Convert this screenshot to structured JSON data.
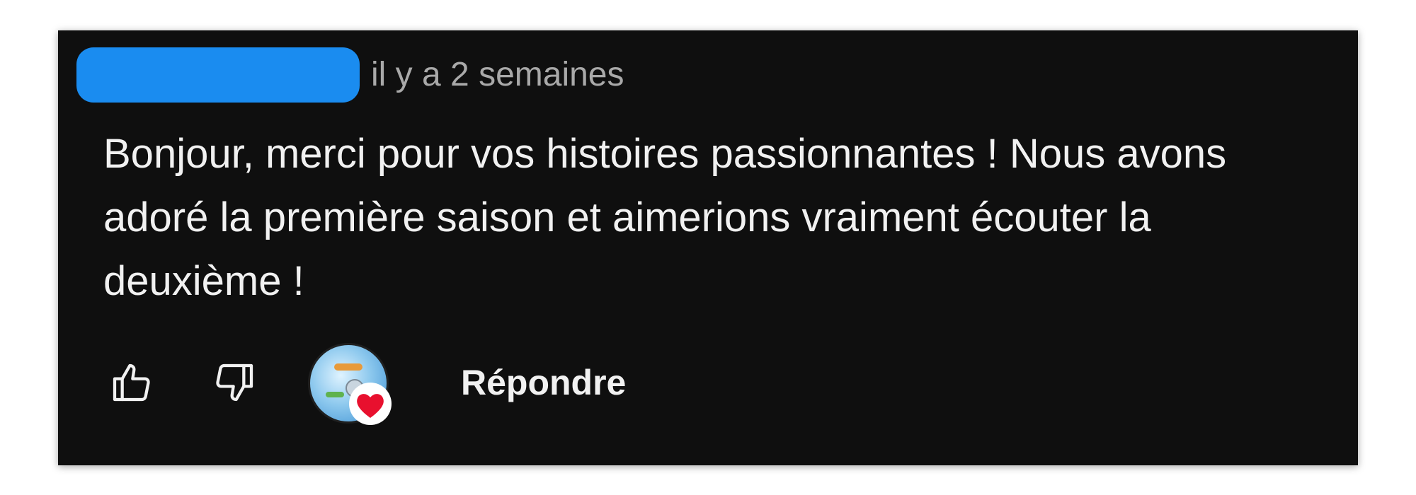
{
  "comment": {
    "timestamp": "il y a 2 semaines",
    "text": "Bonjour, merci pour vos histoires passionnantes ! Nous avons adoré la première saison et aimerions vraiment écouter la deuxième !"
  },
  "actions": {
    "like_icon": "thumbs-up-icon",
    "dislike_icon": "thumbs-down-icon",
    "creator_heart_icon": "heart-icon",
    "reply_label": "Répondre"
  },
  "colors": {
    "background": "#0f0f0f",
    "redaction": "#1a8cf0",
    "heart": "#e8102e",
    "text": "#f1f1f1",
    "muted": "#a9a9a9"
  }
}
